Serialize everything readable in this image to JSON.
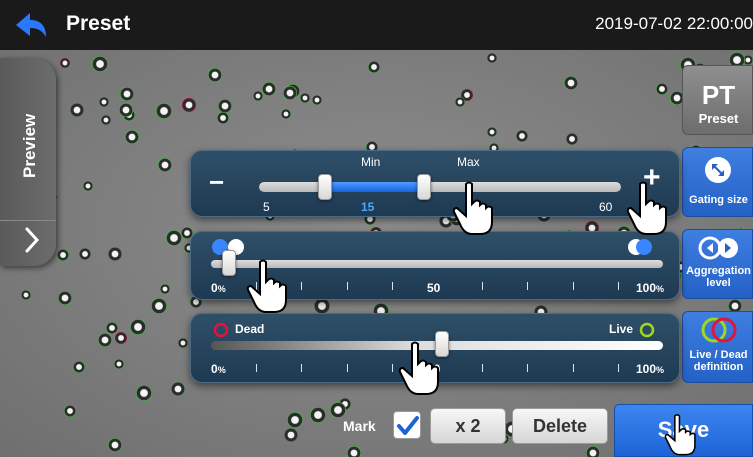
{
  "header": {
    "title": "Preset",
    "datetime": "2019-07-02 22:00:00"
  },
  "sidebar": {
    "preview_label": "Preview"
  },
  "tools": {
    "preset": {
      "big": "PT",
      "label": "Preset"
    },
    "gating": {
      "label": "Gating size"
    },
    "aggregation": {
      "label_line1": "Aggregation",
      "label_line2": "level"
    },
    "livedead": {
      "label_line1": "Live / Dead",
      "label_line2": "definition"
    }
  },
  "gating_panel": {
    "minus": "−",
    "plus": "+",
    "min_label": "Min",
    "max_label": "Max",
    "scale_min": "5",
    "scale_max": "60",
    "min_value": "15",
    "min_value_numeric": 15,
    "max_value_numeric": 30,
    "range": [
      5,
      60
    ]
  },
  "aggregation_panel": {
    "left_label": "0",
    "left_unit": "%",
    "mid_label": "50",
    "right_label": "100",
    "right_unit": "%",
    "value_percent": 4
  },
  "livedead_panel": {
    "dead_label": "Dead",
    "live_label": "Live",
    "left_label": "0",
    "left_unit": "%",
    "mid_label": "50",
    "right_label": "100",
    "right_unit": "%",
    "value_percent": 51
  },
  "bottom": {
    "mark_label": "Mark",
    "mark_checked": true,
    "x2_label": "x 2",
    "delete_label": "Delete",
    "save_label": "Save"
  },
  "colors": {
    "accent": "#2a6fe0",
    "dead": "#c0143c",
    "live": "#9ed81a"
  }
}
